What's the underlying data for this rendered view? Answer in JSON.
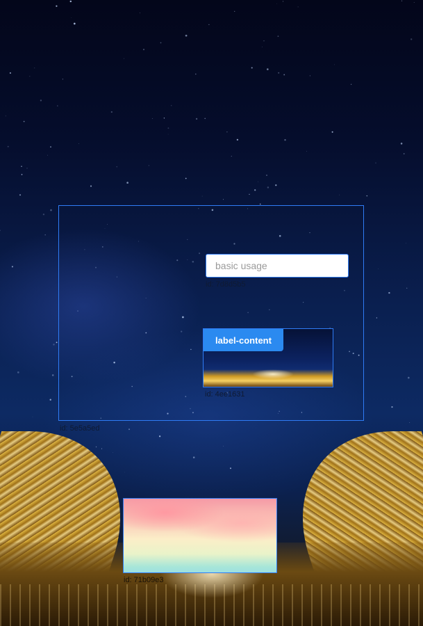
{
  "input": {
    "placeholder": "basic usage",
    "id_label": "id: 7d8d5b5"
  },
  "container": {
    "id_label": "id: 5e5a5ed"
  },
  "image_card": {
    "button_label": "label-content",
    "id_label": "id: 4ee1631"
  },
  "sky_card": {
    "id_label": "id: 71b09e3"
  },
  "colors": {
    "accent": "#2f7cf6",
    "button": "#2b8af0"
  }
}
